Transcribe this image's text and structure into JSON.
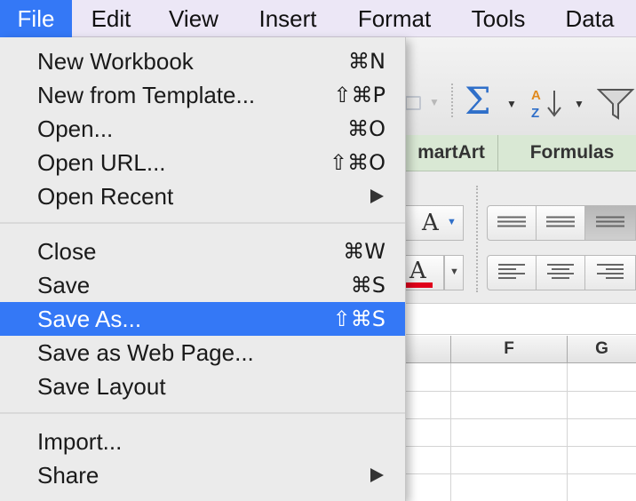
{
  "menubar": {
    "items": [
      {
        "label": "File",
        "active": true
      },
      {
        "label": "Edit"
      },
      {
        "label": "View"
      },
      {
        "label": "Insert"
      },
      {
        "label": "Format"
      },
      {
        "label": "Tools"
      },
      {
        "label": "Data"
      }
    ]
  },
  "file_menu": {
    "groups": [
      [
        {
          "label": "New Workbook",
          "shortcut": "⌘N"
        },
        {
          "label": "New from Template...",
          "shortcut": "⇧⌘P"
        },
        {
          "label": "Open...",
          "shortcut": "⌘O"
        },
        {
          "label": "Open URL...",
          "shortcut": "⇧⌘O"
        },
        {
          "label": "Open Recent",
          "submenu": true
        }
      ],
      [
        {
          "label": "Close",
          "shortcut": "⌘W"
        },
        {
          "label": "Save",
          "shortcut": "⌘S"
        },
        {
          "label": "Save As...",
          "shortcut": "⇧⌘S",
          "highlighted": true
        },
        {
          "label": "Save as Web Page..."
        },
        {
          "label": "Save Layout"
        }
      ],
      [
        {
          "label": "Import..."
        },
        {
          "label": "Share",
          "submenu": true
        }
      ]
    ]
  },
  "toolbar": {
    "autosum_icon": "sigma-icon",
    "sort_icon": "sort-az-icon",
    "filter_icon": "funnel-icon"
  },
  "ribbon": {
    "tabs": [
      "martArt",
      "Formulas"
    ]
  },
  "format_bar": {
    "font_size_glyph": "A",
    "font_color_glyph": "A",
    "font_color": "#e0001b"
  },
  "sheet": {
    "columns": [
      "F",
      "G"
    ]
  },
  "colors": {
    "menu_highlight": "#3478f6",
    "ribbon_tab_bg": "#d9e8d4",
    "menubar_bg": "#ece7f6"
  }
}
